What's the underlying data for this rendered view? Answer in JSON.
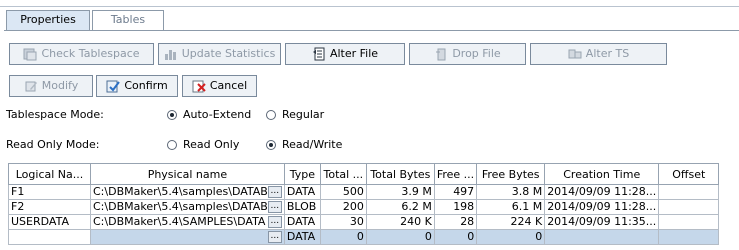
{
  "tabs": [
    {
      "label": "Properties",
      "active": true
    },
    {
      "label": "Tables",
      "active": false
    }
  ],
  "toolbar": {
    "check_tablespace": "Check Tablespace",
    "update_statistics": "Update Statistics",
    "alter_file": "Alter File",
    "drop_file": "Drop File",
    "alter_ts": "Alter TS",
    "modify": "Modify",
    "confirm": "Confirm",
    "cancel": "Cancel"
  },
  "tablespace_mode": {
    "label": "Tablespace Mode:",
    "options": [
      "Auto-Extend",
      "Regular"
    ],
    "selected": "Auto-Extend"
  },
  "read_only_mode": {
    "label": "Read Only Mode:",
    "options": [
      "Read Only",
      "Read/Write"
    ],
    "selected": "Read/Write"
  },
  "table": {
    "columns": [
      "Logical Na...",
      "Physical name",
      "Type",
      "Total ...",
      "Total Bytes",
      "Free ...",
      "Free Bytes",
      "Creation Time",
      "Offset"
    ],
    "rows": [
      {
        "logical": "F1",
        "physical": "C:\\DBMaker\\5.4\\samples\\DATAB",
        "type": "DATA",
        "total": "500",
        "total_bytes": "3.9 M",
        "free": "497",
        "free_bytes": "3.8 M",
        "created": "2014/09/09 11:28...",
        "offset": ""
      },
      {
        "logical": "F2",
        "physical": "C:\\DBMaker\\5.4\\samples\\DATAB",
        "type": "BLOB",
        "total": "200",
        "total_bytes": "6.2 M",
        "free": "198",
        "free_bytes": "6.1 M",
        "created": "2014/09/09 11:28...",
        "offset": ""
      },
      {
        "logical": "USERDATA",
        "physical": "C:\\DBMaker\\5.4\\SAMPLES\\DATA",
        "type": "DATA",
        "total": "30",
        "total_bytes": "240 K",
        "free": "28",
        "free_bytes": "224 K",
        "created": "2014/09/09 11:35...",
        "offset": ""
      },
      {
        "logical": "",
        "physical": "",
        "type": "DATA",
        "total": "0",
        "total_bytes": "0",
        "free": "0",
        "free_bytes": "0",
        "created": "",
        "offset": ""
      }
    ],
    "browse_label": "..."
  }
}
